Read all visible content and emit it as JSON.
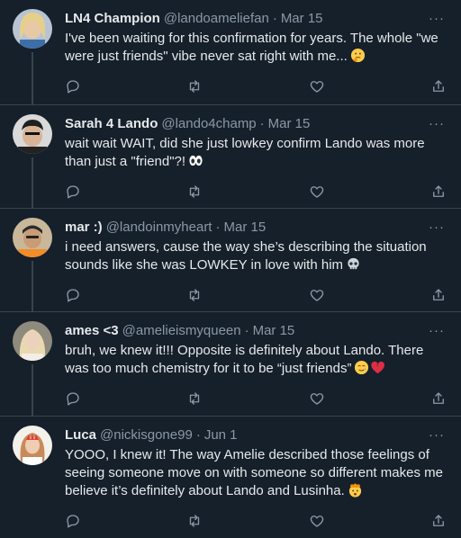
{
  "tweets": [
    {
      "name": "LN4 Champion",
      "handle": "@landoameliefan",
      "date": "Mar 15",
      "text": "I've been waiting for this confirmation for years. The whole \"we were just friends\" vibe never sat right with me...",
      "emojis": [
        "thinking-face"
      ]
    },
    {
      "name": "Sarah 4 Lando",
      "handle": "@lando4champ",
      "date": "Mar 15",
      "text": "wait wait WAIT, did she just lowkey confirm Lando was more than just a \"friend\"?!",
      "emojis": [
        "eyes"
      ]
    },
    {
      "name": "mar :)",
      "handle": "@landoinmyheart",
      "date": "Mar 15",
      "text": "i need answers, cause the way she’s describing the situation sounds like she was LOWKEY in love with him",
      "emojis": [
        "skull"
      ]
    },
    {
      "name": "ames <3",
      "handle": "@amelieismyqueen",
      "date": "Mar 15",
      "text": "bruh, we knew it!!! Opposite is definitely about Lando. There was too much chemistry for it to be “just friends”",
      "emojis": [
        "smiling-face-with-tear",
        "broken-heart"
      ]
    },
    {
      "name": "Luca",
      "handle": "@nickisgone99",
      "date": "Jun 1",
      "text": "YOOO, I knew it! The way Amelie described those feelings of seeing someone move on with someone so different makes me believe it’s definitely about Lando and Lusinha.",
      "emojis": [
        "exploding-head"
      ]
    }
  ],
  "colors": {
    "background": "#15202b",
    "text": "#e7e9ea",
    "muted": "#8b98a5",
    "divider": "#38444d"
  },
  "icons": {
    "actions": [
      "reply-icon",
      "retweet-icon",
      "like-icon",
      "share-icon"
    ],
    "menu": "more-icon"
  }
}
